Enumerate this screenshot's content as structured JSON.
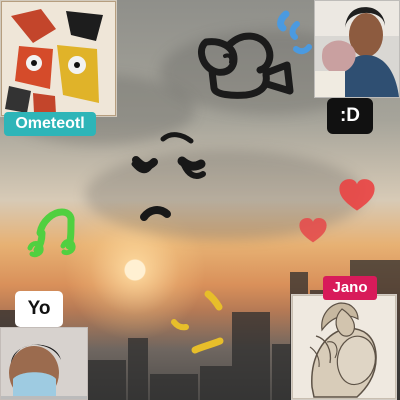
{
  "participants": [
    {
      "name": "Ometeotl"
    },
    {
      "name": ":D"
    },
    {
      "name": "Yo"
    },
    {
      "name": "Jano"
    }
  ]
}
